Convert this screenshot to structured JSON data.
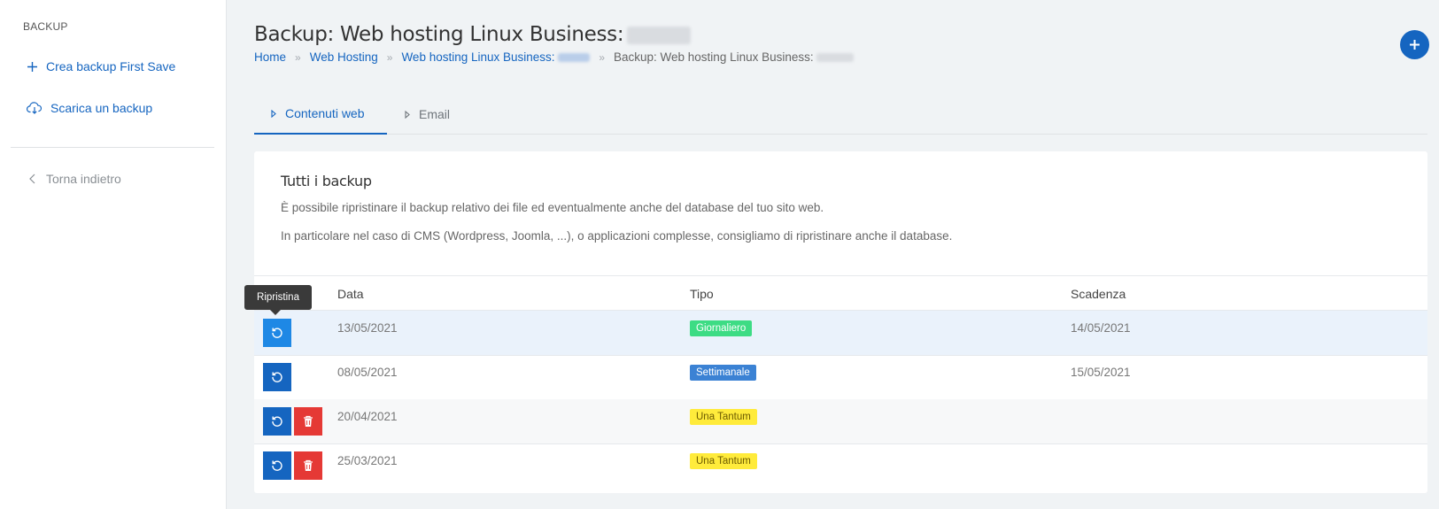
{
  "sidebar": {
    "heading": "BACKUP",
    "create_label": "Crea backup First Save",
    "download_label": "Scarica un backup",
    "back_label": "Torna indietro"
  },
  "header": {
    "title": "Backup: Web hosting Linux Business:",
    "breadcrumb": {
      "home": "Home",
      "web_hosting": "Web Hosting",
      "service": "Web hosting Linux Business:",
      "current": "Backup: Web hosting Linux Business:",
      "separator": "»"
    }
  },
  "tabs": [
    {
      "label": "Contenuti web",
      "active": true
    },
    {
      "label": "Email",
      "active": false
    }
  ],
  "card": {
    "title": "Tutti i backup",
    "paragraph1": "È possibile ripristinare il backup relativo dei file ed eventualmente anche del database del tuo sito web.",
    "paragraph2": "In particolare nel caso di CMS (Wordpress, Joomla, ...), o applicazioni complesse, consigliamo di ripristinare anche il database."
  },
  "table": {
    "columns": [
      "Data",
      "Tipo",
      "Scadenza"
    ],
    "rows": [
      {
        "data": "13/05/2021",
        "tipo": "Giornaliero",
        "scadenza": "14/05/2021"
      },
      {
        "data": "08/05/2021",
        "tipo": "Settimanale",
        "scadenza": "15/05/2021"
      },
      {
        "data": "20/04/2021",
        "tipo": "Una Tantum",
        "scadenza": ""
      },
      {
        "data": "25/03/2021",
        "tipo": "Una Tantum",
        "scadenza": ""
      }
    ]
  },
  "tooltip": {
    "label": "Ripristina"
  },
  "colors": {
    "primary": "#1565c0",
    "active_restore": "#1e88e5",
    "danger": "#e53935",
    "badge_daily": "#3ddc84",
    "badge_weekly": "#3b82d4",
    "badge_oneoff": "#ffeb3b"
  },
  "icons": {
    "plus": "plus-icon",
    "cloud_download": "cloud-download-icon",
    "chevron_left": "chevron-left-icon",
    "triangle_right": "triangle-right-icon",
    "restore": "restore-icon",
    "trash": "trash-icon"
  }
}
